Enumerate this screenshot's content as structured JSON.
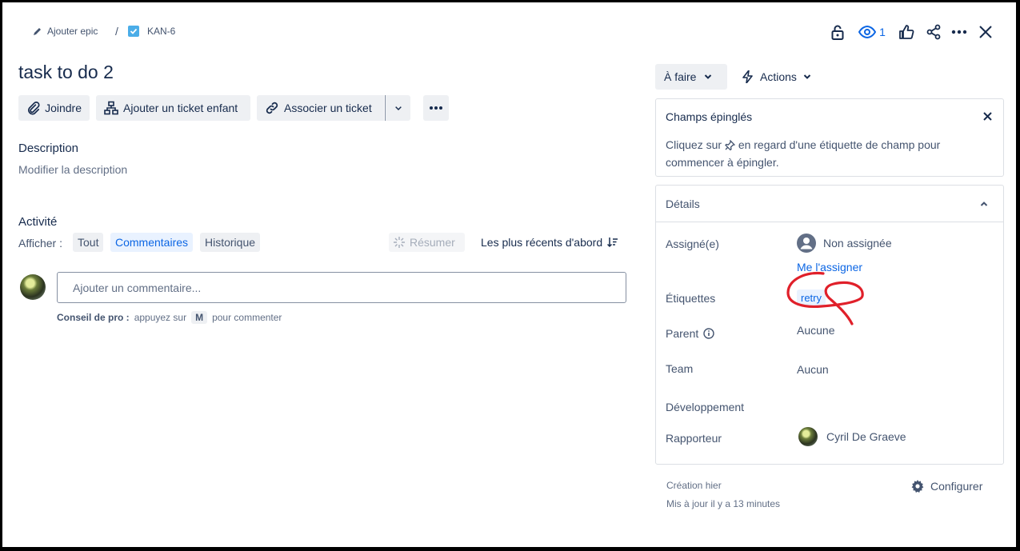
{
  "breadcrumb": {
    "add_epic": "Ajouter epic",
    "separator": "/",
    "issue_key": "KAN-6"
  },
  "header_icons": {
    "watch_count": "1"
  },
  "issue": {
    "title": "task to do 2"
  },
  "toolbar": {
    "attach": "Joindre",
    "add_child": "Ajouter un ticket enfant",
    "link_issue": "Associer un ticket"
  },
  "description": {
    "heading": "Description",
    "placeholder": "Modifier la description"
  },
  "activity": {
    "heading": "Activité",
    "show_label": "Afficher :",
    "filters": [
      "Tout",
      "Commentaires",
      "Historique"
    ],
    "summarize": "Résumer",
    "sort": "Les plus récents d'abord",
    "comment_placeholder": "Ajouter un commentaire...",
    "pro_tip_label": "Conseil de pro :",
    "pro_tip_text1": "appuyez sur",
    "pro_tip_key": "M",
    "pro_tip_text2": "pour commenter"
  },
  "status": {
    "label": "À faire",
    "actions": "Actions"
  },
  "pinned": {
    "title": "Champs épinglés",
    "text1": "Cliquez sur",
    "text2": "en regard d'une étiquette de champ pour",
    "text3": "commencer à épingler."
  },
  "details": {
    "title": "Détails",
    "assignee_label": "Assigné(e)",
    "assignee_value": "Non assignée",
    "assign_me": "Me l'assigner",
    "labels_label": "Étiquettes",
    "label_tag": "retry",
    "parent_label": "Parent",
    "parent_value": "Aucune",
    "team_label": "Team",
    "team_value": "Aucun",
    "dev_label": "Développement",
    "reporter_label": "Rapporteur",
    "reporter_value": "Cyril De Graeve"
  },
  "footer": {
    "created": "Création hier",
    "updated": "Mis à jour il y a 13 minutes",
    "configure": "Configurer"
  },
  "colors": {
    "accent": "#0c66e4",
    "annotation": "#e0202a"
  }
}
